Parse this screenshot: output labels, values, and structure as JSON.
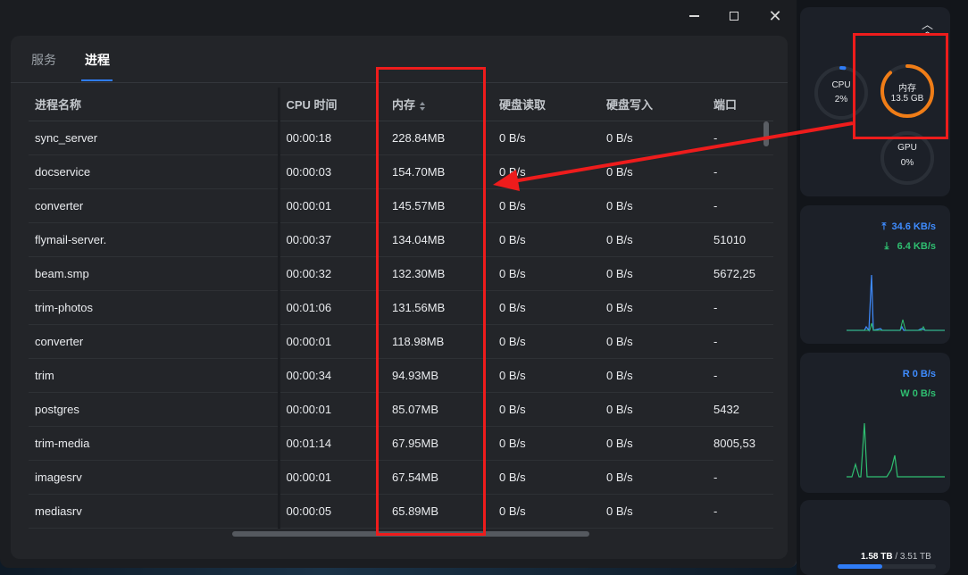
{
  "tabs": [
    {
      "label": "服务",
      "active": false
    },
    {
      "label": "进程",
      "active": true
    }
  ],
  "table": {
    "columns": [
      "进程名称",
      "CPU 时间",
      "内存",
      "硬盘读取",
      "硬盘写入",
      "端口"
    ],
    "sorted_column": "内存",
    "rows": [
      [
        "sync_server",
        "00:00:18",
        "228.84MB",
        "0 B/s",
        "0 B/s",
        "-"
      ],
      [
        "docservice",
        "00:00:03",
        "154.70MB",
        "0 B/s",
        "0 B/s",
        "-"
      ],
      [
        "converter",
        "00:00:01",
        "145.57MB",
        "0 B/s",
        "0 B/s",
        "-"
      ],
      [
        "flymail-server.",
        "00:00:37",
        "134.04MB",
        "0 B/s",
        "0 B/s",
        "51010"
      ],
      [
        "beam.smp",
        "00:00:32",
        "132.30MB",
        "0 B/s",
        "0 B/s",
        "5672,25"
      ],
      [
        "trim-photos",
        "00:01:06",
        "131.56MB",
        "0 B/s",
        "0 B/s",
        "-"
      ],
      [
        "converter",
        "00:00:01",
        "118.98MB",
        "0 B/s",
        "0 B/s",
        "-"
      ],
      [
        "trim",
        "00:00:34",
        "94.93MB",
        "0 B/s",
        "0 B/s",
        "-"
      ],
      [
        "postgres",
        "00:00:01",
        "85.07MB",
        "0 B/s",
        "0 B/s",
        "5432"
      ],
      [
        "trim-media",
        "00:01:14",
        "67.95MB",
        "0 B/s",
        "0 B/s",
        "8005,53"
      ],
      [
        "imagesrv",
        "00:00:01",
        "67.54MB",
        "0 B/s",
        "0 B/s",
        "-"
      ],
      [
        "mediasrv",
        "00:00:05",
        "65.89MB",
        "0 B/s",
        "0 B/s",
        "-"
      ]
    ]
  },
  "monitor": {
    "cpu": {
      "label": "CPU",
      "value": "2%",
      "fraction": 0.02,
      "color": "#2f7cf6"
    },
    "memory": {
      "label": "内存",
      "value": "13.5 GB",
      "fraction": 0.88,
      "color": "#f07d17"
    },
    "gpu": {
      "label": "GPU",
      "value": "0%",
      "fraction": 0.0
    },
    "network": {
      "upload": "34.6 KB/s",
      "download": "6.4 KB/s"
    },
    "disk": {
      "read": "R 0 B/s",
      "write": "W 0 B/s"
    },
    "storage": {
      "used": "1.58 TB",
      "total": "3.51 TB",
      "fraction": 0.45
    }
  },
  "icons": [
    "minimize-icon",
    "maximize-icon",
    "close-icon",
    "sort-icon",
    "collapse-up-icon",
    "upload-arrow-icon",
    "download-arrow-icon"
  ],
  "colors": {
    "accent": "#2f7cf6",
    "memory_ring": "#f07d17",
    "annotation": "#ee1c1c",
    "net_up": "#3f8cff",
    "net_down": "#2fbf71"
  }
}
